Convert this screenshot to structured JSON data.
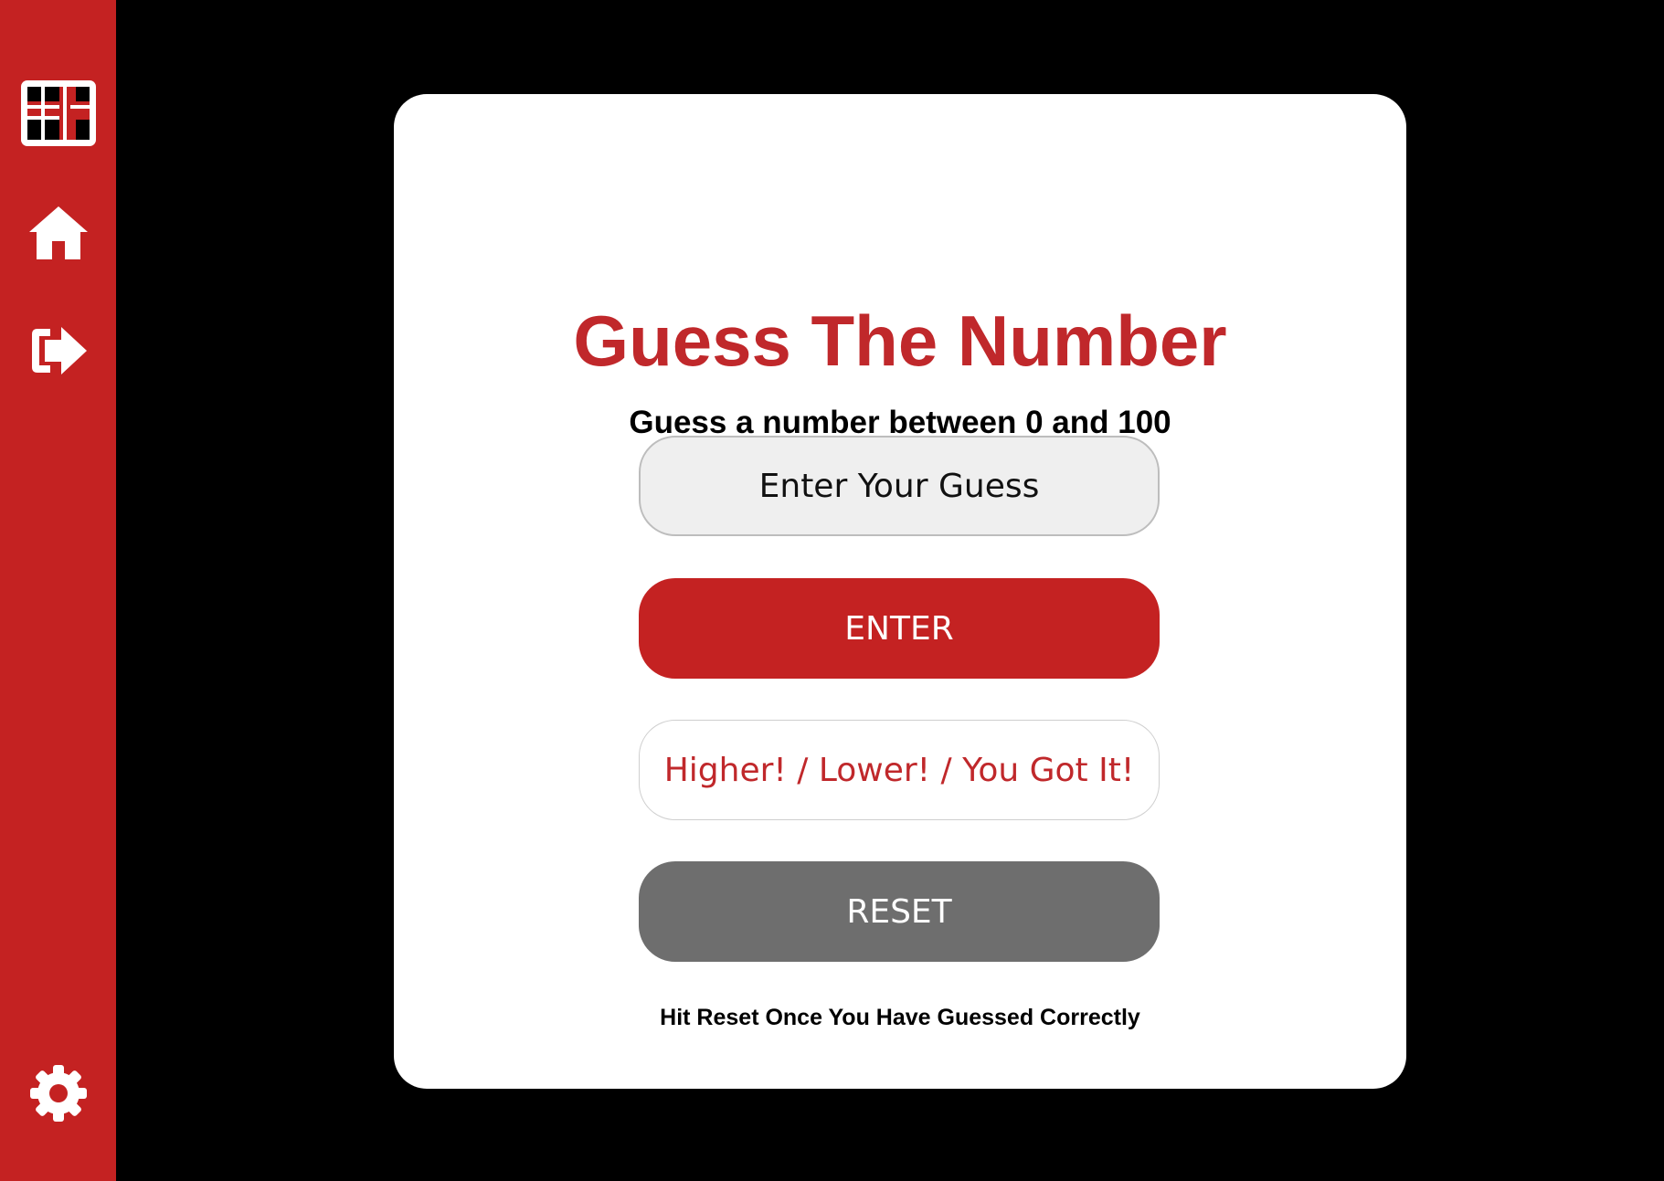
{
  "colors": {
    "sidebar": "#c42222",
    "background": "#000000",
    "card": "#ffffff",
    "title": "#c0282b",
    "enter_button": "#c42222",
    "reset_button": "#6e6e6e",
    "input_background": "#efefef"
  },
  "sidebar": {
    "icons": [
      "logo-icon",
      "home-icon",
      "logout-icon",
      "gear-icon"
    ]
  },
  "game": {
    "title": "Guess The Number",
    "subtitle": "Guess a number between 0 and 100",
    "input_placeholder": "Enter Your Guess",
    "input_value": "",
    "enter_label": "ENTER",
    "feedback_text": "Higher! / Lower! / You Got It!",
    "reset_label": "RESET",
    "hint": "Hit Reset Once You Have Guessed Correctly"
  }
}
